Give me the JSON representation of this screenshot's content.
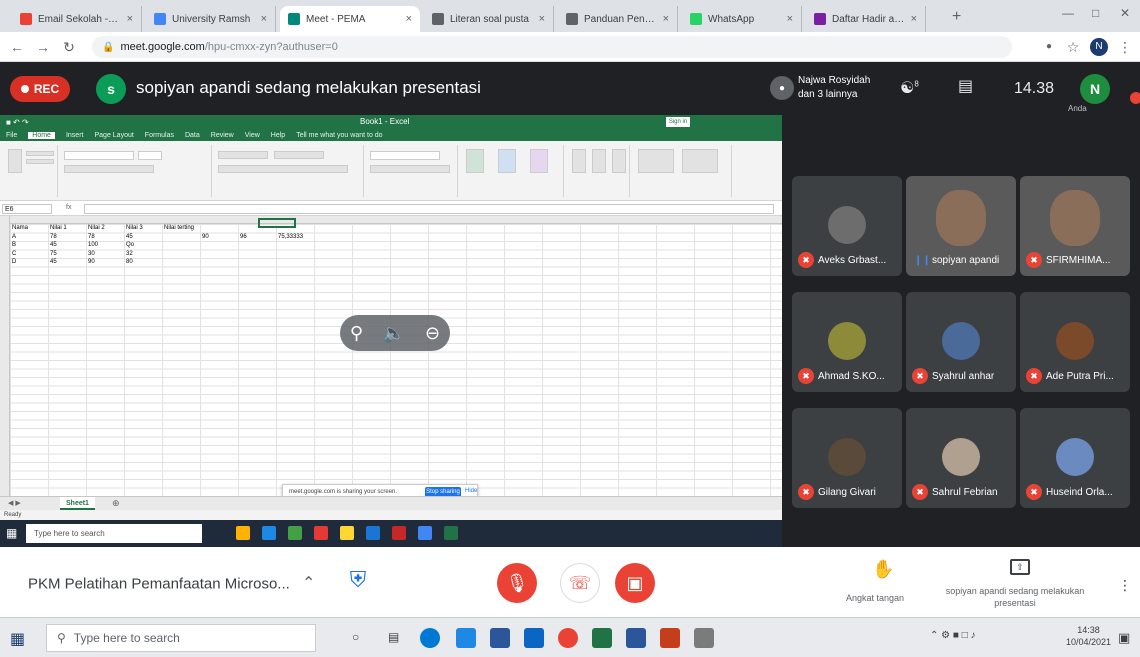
{
  "browser": {
    "tabs": [
      {
        "title": "Email Sekolah - e...",
        "color": "#ea4335"
      },
      {
        "title": "University Ramsh",
        "color": "#4285f4"
      },
      {
        "title": "Meet - PEMA",
        "color": "#00897b",
        "active": true
      },
      {
        "title": "Literan soal pusta",
        "color": "#5f6368"
      },
      {
        "title": "Panduan Penggu",
        "color": "#5f6368"
      },
      {
        "title": "WhatsApp",
        "color": "#25d366"
      },
      {
        "title": "Daftar Hadir acara",
        "color": "#7b1fa2"
      }
    ],
    "url_host": "meet.google.com",
    "url_path": "/hpu-cmxx-zyn?authuser=0",
    "profile_initial": "N"
  },
  "meet": {
    "rec_label": "REC",
    "presenter_initial": "s",
    "presenting_text": "sopiyan apandi sedang melakukan presentasi",
    "attendee_summary": "Najwa Rosyidah dan 3 lainnya",
    "participant_count": "8",
    "time": "14.38",
    "self_initial": "N",
    "self_label": "Anda",
    "meeting_title": "PKM Pelatihan Pemanfaatan Microso...",
    "raise_hand_label": "Angkat tangan",
    "presenting_footer": "sopiyan apandi sedang melakukan presentasi"
  },
  "excel": {
    "title": "Book1 - Excel",
    "signin": "Sign in",
    "menu": [
      "File",
      "Home",
      "Insert",
      "Page Layout",
      "Formulas",
      "Data",
      "Review",
      "View",
      "Help",
      "Tell me what you want to do"
    ],
    "namebox": "E6",
    "fx": "fx",
    "sheet": "Sheet1",
    "status": "Ready",
    "cells": [
      {
        "r": 0,
        "c": 0,
        "v": "Nama"
      },
      {
        "r": 0,
        "c": 1,
        "v": "Nilai 1"
      },
      {
        "r": 0,
        "c": 2,
        "v": "Nilai 2"
      },
      {
        "r": 0,
        "c": 3,
        "v": "Nilai 3"
      },
      {
        "r": 0,
        "c": 4,
        "v": "Nilai terting"
      },
      {
        "r": 1,
        "c": 0,
        "v": "A"
      },
      {
        "r": 1,
        "c": 1,
        "v": "78"
      },
      {
        "r": 1,
        "c": 2,
        "v": "78"
      },
      {
        "r": 1,
        "c": 3,
        "v": "45"
      },
      {
        "r": 1,
        "c": 5,
        "v": "90"
      },
      {
        "r": 1,
        "c": 6,
        "v": "96"
      },
      {
        "r": 1,
        "c": 7,
        "v": "75,33333"
      },
      {
        "r": 2,
        "c": 0,
        "v": "B"
      },
      {
        "r": 2,
        "c": 1,
        "v": "45"
      },
      {
        "r": 2,
        "c": 2,
        "v": "100"
      },
      {
        "r": 2,
        "c": 3,
        "v": "Qo"
      },
      {
        "r": 3,
        "c": 0,
        "v": "C"
      },
      {
        "r": 3,
        "c": 1,
        "v": "75"
      },
      {
        "r": 3,
        "c": 2,
        "v": "30"
      },
      {
        "r": 3,
        "c": 3,
        "v": "32"
      },
      {
        "r": 4,
        "c": 0,
        "v": "D"
      },
      {
        "r": 4,
        "c": 1,
        "v": "45"
      },
      {
        "r": 4,
        "c": 2,
        "v": "90"
      },
      {
        "r": 4,
        "c": 3,
        "v": "80"
      }
    ],
    "share_text": "meet.google.com is sharing your screen.",
    "stop_sharing": "Stop sharing",
    "hide": "Hide",
    "taskbar_search": "Type here to search"
  },
  "participants": [
    {
      "name": "Aveks Grbast...",
      "muted": true,
      "avatar_color": "#6d6d6d"
    },
    {
      "name": "sopiyan apandi",
      "muted": false,
      "speaking": true,
      "camera": true
    },
    {
      "name": "SFIRMHIMA...",
      "muted": true,
      "camera": true
    },
    {
      "name": "Ahmad S.KO...",
      "muted": true,
      "avatar_color": "#8d8a3a"
    },
    {
      "name": "Syahrul anhar",
      "muted": true,
      "avatar_color": "#4a6a9a"
    },
    {
      "name": "Ade Putra Pri...",
      "muted": true,
      "avatar_color": "#7a4a2a"
    },
    {
      "name": "Gilang Givari",
      "muted": true,
      "avatar_color": "#5a4a3a"
    },
    {
      "name": "Sahrul Febrian",
      "muted": true,
      "avatar_color": "#b0a090"
    },
    {
      "name": "Huseind Orla...",
      "muted": true,
      "avatar_color": "#6a8ac0"
    }
  ],
  "taskbar": {
    "search": "Type here to search",
    "time": "14:38",
    "date": "10/04/2021"
  }
}
